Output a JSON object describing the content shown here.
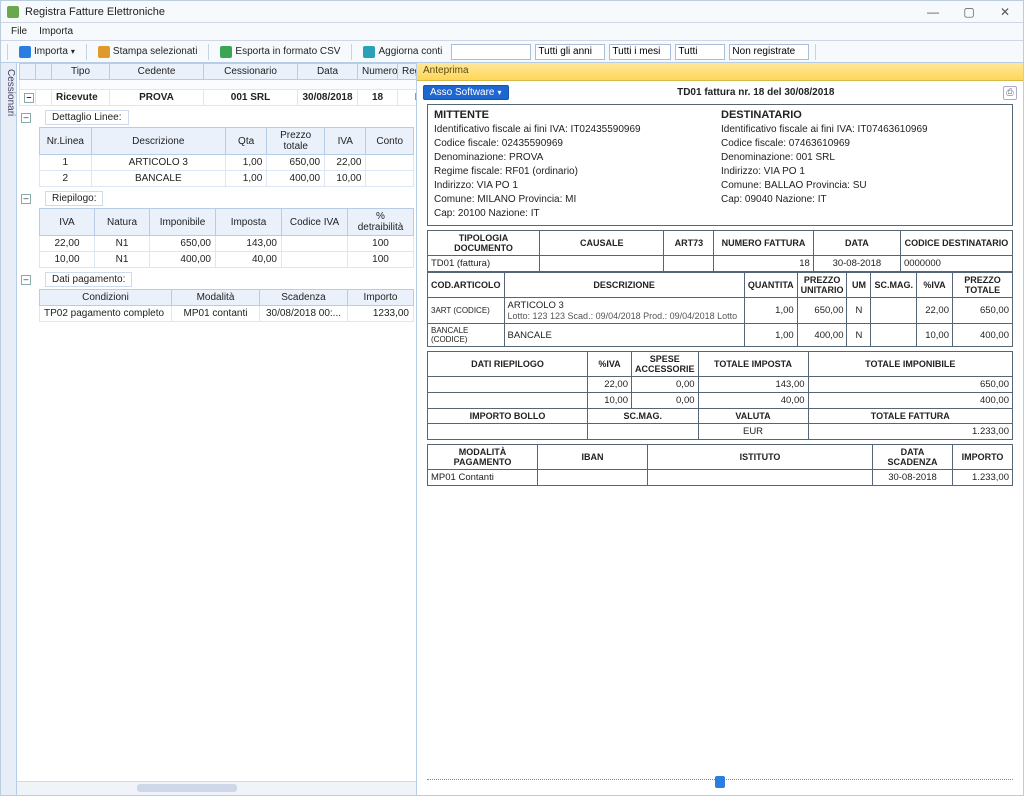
{
  "window": {
    "title": "Registra Fatture Elettroniche"
  },
  "menu": {
    "file": "File",
    "importa": "Importa"
  },
  "toolbar": {
    "importa": "Importa",
    "stampa": "Stampa selezionati",
    "esporta": "Esporta in formato CSV",
    "aggiorna": "Aggiorna conti",
    "sel_anni": "Tutti gli anni",
    "sel_mesi": "Tutti i mesi",
    "sel_tutti": "Tutti",
    "sel_reg": "Non registrate"
  },
  "sidetab": "Cessionari",
  "maingrid": {
    "headers": {
      "tipo": "Tipo",
      "cedente": "Cedente",
      "cessionario": "Cessionario",
      "data": "Data",
      "numero": "Numero",
      "registrata": "Registrata"
    },
    "row": {
      "tipo": "Ricevute",
      "cedente": "PROVA",
      "cessionario": "001 SRL",
      "data": "30/08/2018",
      "numero": "18",
      "registrata": "No"
    }
  },
  "dettaglio": {
    "label": "Dettaglio Linee:",
    "headers": {
      "nr": "Nr.Linea",
      "desc": "Descrizione",
      "qta": "Qta",
      "prezzo": "Prezzo totale",
      "iva": "IVA",
      "conto": "Conto"
    },
    "rows": [
      {
        "nr": "1",
        "desc": "ARTICOLO 3",
        "qta": "1,00",
        "prezzo": "650,00",
        "iva": "22,00",
        "conto": ""
      },
      {
        "nr": "2",
        "desc": "BANCALE",
        "qta": "1,00",
        "prezzo": "400,00",
        "iva": "10,00",
        "conto": ""
      }
    ]
  },
  "riepilogo": {
    "label": "Riepilogo:",
    "headers": {
      "iva": "IVA",
      "natura": "Natura",
      "imponibile": "Imponibile",
      "imposta": "Imposta",
      "codiva": "Codice IVA",
      "detr": "% detraibilità"
    },
    "rows": [
      {
        "iva": "22,00",
        "natura": "N1",
        "imponibile": "650,00",
        "imposta": "143,00",
        "codiva": "",
        "detr": "100"
      },
      {
        "iva": "10,00",
        "natura": "N1",
        "imponibile": "400,00",
        "imposta": "40,00",
        "codiva": "",
        "detr": "100"
      }
    ]
  },
  "pagamento": {
    "label": "Dati pagamento:",
    "headers": {
      "cond": "Condizioni",
      "mod": "Modalità",
      "scad": "Scadenza",
      "imp": "Importo"
    },
    "row": {
      "cond": "TP02 pagamento completo",
      "mod": "MP01 contanti",
      "scad": "30/08/2018 00:...",
      "imp": "1233,00"
    }
  },
  "preview": {
    "tab": "Anteprima",
    "swbtn": "Asso Software",
    "title": "TD01 fattura nr. 18 del 30/08/2018",
    "mittente": {
      "head": "MITTENTE",
      "idfisc": "Identificativo fiscale ai fini IVA: IT02435590969",
      "cf": "Codice fiscale: 02435590969",
      "den": "Denominazione: PROVA",
      "reg": "Regime fiscale: RF01 (ordinario)",
      "ind": "Indirizzo: VIA PO 1",
      "com": "Comune: MILANO Provincia: MI",
      "cap": "Cap: 20100 Nazione: IT"
    },
    "dest": {
      "head": "DESTINATARIO",
      "idfisc": "Identificativo fiscale ai fini IVA: IT07463610969",
      "cf": "Codice fiscale: 07463610969",
      "den": "Denominazione: 001 SRL",
      "ind": "Indirizzo: VIA PO 1",
      "com": "Comune: BALLAO Provincia: SU",
      "cap": "Cap: 09040 Nazione: IT"
    },
    "docrow": {
      "h_tipo": "TIPOLOGIA DOCUMENTO",
      "h_caus": "CAUSALE",
      "h_art": "ART73",
      "h_num": "NUMERO FATTURA",
      "h_data": "DATA",
      "h_cod": "CODICE DESTINATARIO",
      "tipo": "TD01 (fattura)",
      "caus": "",
      "art": "",
      "num": "18",
      "data": "30-08-2018",
      "cod": "0000000"
    },
    "lines": {
      "h_cod": "COD.ARTICOLO",
      "h_desc": "DESCRIZIONE",
      "h_qta": "QUANTITA",
      "h_pu": "PREZZO UNITARIO",
      "h_um": "UM",
      "h_sc": "SC.MAG.",
      "h_iva": "%IVA",
      "h_pt": "PREZZO TOTALE",
      "rows": [
        {
          "cod": "3ART (CODICE)",
          "desc": "ARTICOLO 3",
          "sub": "Lotto: 123 123 Scad.: 09/04/2018 Prod.: 09/04/2018 Lotto",
          "qta": "1,00",
          "pu": "650,00",
          "um": "N",
          "sc": "",
          "iva": "22,00",
          "pt": "650,00"
        },
        {
          "cod": "BANCALE (CODICE)",
          "desc": "BANCALE",
          "sub": "",
          "qta": "1,00",
          "pu": "400,00",
          "um": "N",
          "sc": "",
          "iva": "10,00",
          "pt": "400,00"
        }
      ]
    },
    "riep": {
      "h_dati": "DATI RIEPILOGO",
      "h_iva": "%IVA",
      "h_spese": "SPESE ACCESSORIE",
      "h_imposta": "TOTALE IMPOSTA",
      "h_imponibile": "TOTALE IMPONIBILE",
      "rows": [
        {
          "iva": "22,00",
          "spese": "0,00",
          "imposta": "143,00",
          "imponibile": "650,00"
        },
        {
          "iva": "10,00",
          "spese": "0,00",
          "imposta": "40,00",
          "imponibile": "400,00"
        }
      ],
      "h_bollo": "IMPORTO BOLLO",
      "h_sc": "SC.MAG.",
      "h_val": "VALUTA",
      "h_tot": "TOTALE FATTURA",
      "bollo": "",
      "sc": "",
      "val": "EUR",
      "tot": "1.233,00"
    },
    "pag": {
      "h_mod": "MODALITÀ PAGAMENTO",
      "h_iban": "IBAN",
      "h_ist": "ISTITUTO",
      "h_scad": "DATA SCADENZA",
      "h_imp": "IMPORTO",
      "mod": "MP01 Contanti",
      "iban": "",
      "ist": "",
      "scad": "30-08-2018",
      "imp": "1.233,00"
    }
  }
}
